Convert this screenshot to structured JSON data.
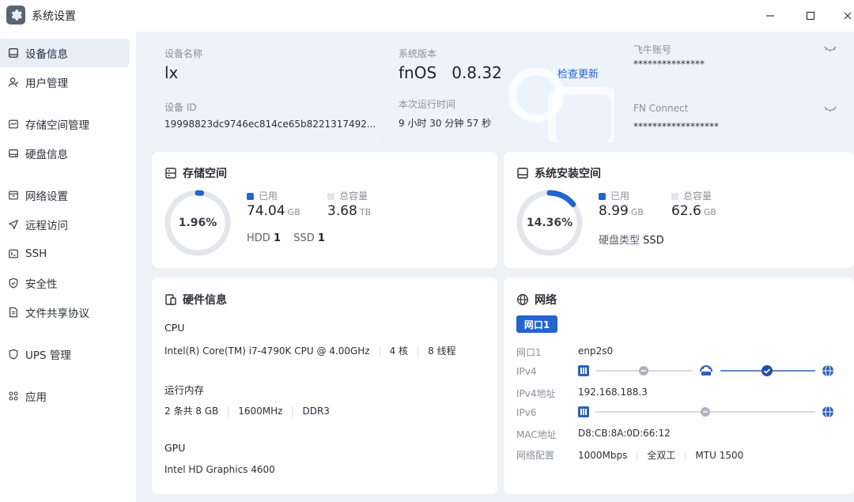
{
  "window": {
    "title": "系统设置"
  },
  "sidebar": {
    "items": [
      {
        "label": "设备信息",
        "icon": "monitor-icon",
        "active": true
      },
      {
        "label": "用户管理",
        "icon": "user-icon"
      },
      {
        "label": "存储空间管理",
        "icon": "storage-icon"
      },
      {
        "label": "硬盘信息",
        "icon": "disk-icon"
      },
      {
        "label": "网络设置",
        "icon": "network-icon"
      },
      {
        "label": "远程访问",
        "icon": "send-icon"
      },
      {
        "label": "SSH",
        "icon": "terminal-icon"
      },
      {
        "label": "安全性",
        "icon": "shield-icon"
      },
      {
        "label": "文件共享协议",
        "icon": "file-icon"
      },
      {
        "label": "UPS 管理",
        "icon": "ups-shield-icon"
      },
      {
        "label": "应用",
        "icon": "apps-icon"
      }
    ]
  },
  "device": {
    "name_label": "设备名称",
    "name": "lx",
    "id_label": "设备 ID",
    "id": "19998823dc9746ec814ce65b8221317492..."
  },
  "system": {
    "version_label": "系统版本",
    "version": "fnOS   0.8.32",
    "check_update": "检查更新",
    "uptime_label": "本次运行时间",
    "uptime": "9 小时 30 分钟 57 秒"
  },
  "feiniu": {
    "label": "飞牛账号",
    "value": "***************"
  },
  "fnconnect": {
    "label": "FN Connect",
    "value": "******************"
  },
  "storage": {
    "title": "存储空间",
    "percent_text": "1.96%",
    "percent": 1.96,
    "used_label": "已用",
    "used_value": "74.04",
    "used_unit": "GB",
    "total_label": "总容量",
    "total_value": "3.68",
    "total_unit": "TB",
    "hdd_label": "HDD",
    "hdd_count": "1",
    "ssd_label": "SSD",
    "ssd_count": "1"
  },
  "sysdisk": {
    "title": "系统安装空间",
    "percent_text": "14.36%",
    "percent": 14.36,
    "used_label": "已用",
    "used_value": "8.99",
    "used_unit": "GB",
    "total_label": "总容量",
    "total_value": "62.6",
    "total_unit": "GB",
    "type_label": "硬盘类型",
    "type_value": "SSD"
  },
  "hardware": {
    "title": "硬件信息",
    "cpu_label": "CPU",
    "cpu_model": "Intel(R) Core(TM) i7-4790K CPU @ 4.00GHz",
    "cpu_cores": "4 核",
    "cpu_threads": "8 线程",
    "mem_label": "运行内存",
    "mem_size": "2 条共 8 GB",
    "mem_speed": "1600MHz",
    "mem_type": "DDR3",
    "gpu_label": "GPU",
    "gpu_model": "Intel HD Graphics 4600"
  },
  "network": {
    "title": "网络",
    "tab": "网口1",
    "port_label": "网口1",
    "port_value": "enp2s0",
    "ipv4_label": "IPv4",
    "ipv4addr_label": "IPv4地址",
    "ipv4addr_value": "192.168.188.3",
    "ipv6_label": "IPv6",
    "mac_label": "MAC地址",
    "mac_value": "D8:CB:8A:0D:66:12",
    "config_label": "网络配置",
    "speed": "1000Mbps",
    "duplex": "全双工",
    "mtu": "MTU 1500"
  },
  "colors": {
    "accent": "#2264d1",
    "ring_track": "#e3e6eb",
    "card_blue": "#edf3fb"
  }
}
